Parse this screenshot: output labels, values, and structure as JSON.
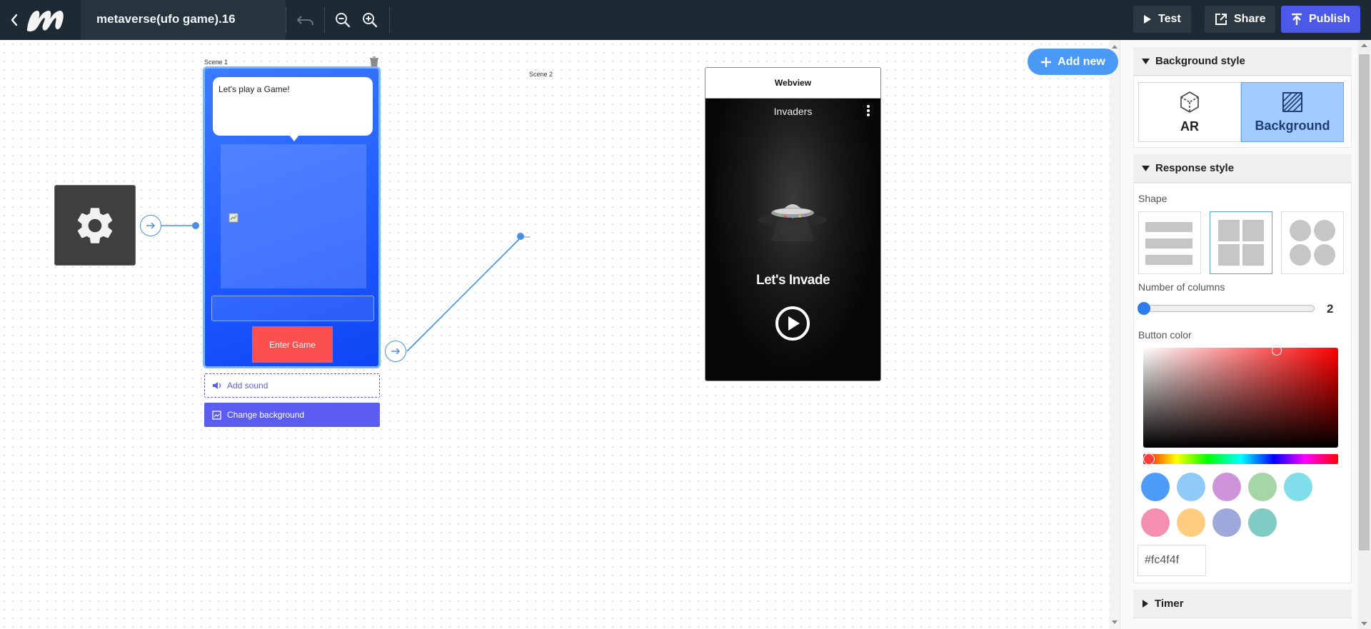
{
  "app": {
    "title": "metaverse(ufo game).16"
  },
  "toolbar": {
    "test_label": "Test",
    "share_label": "Share",
    "publish_label": "Publish",
    "icons": [
      "back-icon",
      "logo-icon",
      "undo-icon",
      "zoom-out-icon",
      "zoom-in-icon"
    ]
  },
  "canvas": {
    "add_new_label": "Add new",
    "scene1": {
      "label": "Scene 1",
      "message": "Let's play a Game!",
      "button_label": "Enter Game",
      "add_sound_label": "Add sound",
      "change_background_label": "Change background"
    },
    "scene2": {
      "label": "Scene 2",
      "webview_label": "Webview",
      "video_title": "Invaders",
      "video_caption": "Let's Invade"
    }
  },
  "panel": {
    "background_style": {
      "heading": "Background style",
      "options": [
        "AR",
        "Background"
      ],
      "selected": "Background"
    },
    "response_style": {
      "heading": "Response style",
      "shape_label": "Shape",
      "shapes": [
        "list",
        "grid",
        "circles"
      ],
      "selected_shape": "grid",
      "columns_label": "Number of columns",
      "columns_value": "2",
      "button_color_label": "Button color",
      "swatches": [
        "#4d9cf7",
        "#90caf9",
        "#ce93d8",
        "#a5d6a7",
        "#80deea",
        "#f48fb1",
        "#ffcc80",
        "#9fa8da",
        "#80cbc4"
      ],
      "hex_value": "#fc4f4f"
    },
    "timer": {
      "heading": "Timer"
    }
  }
}
